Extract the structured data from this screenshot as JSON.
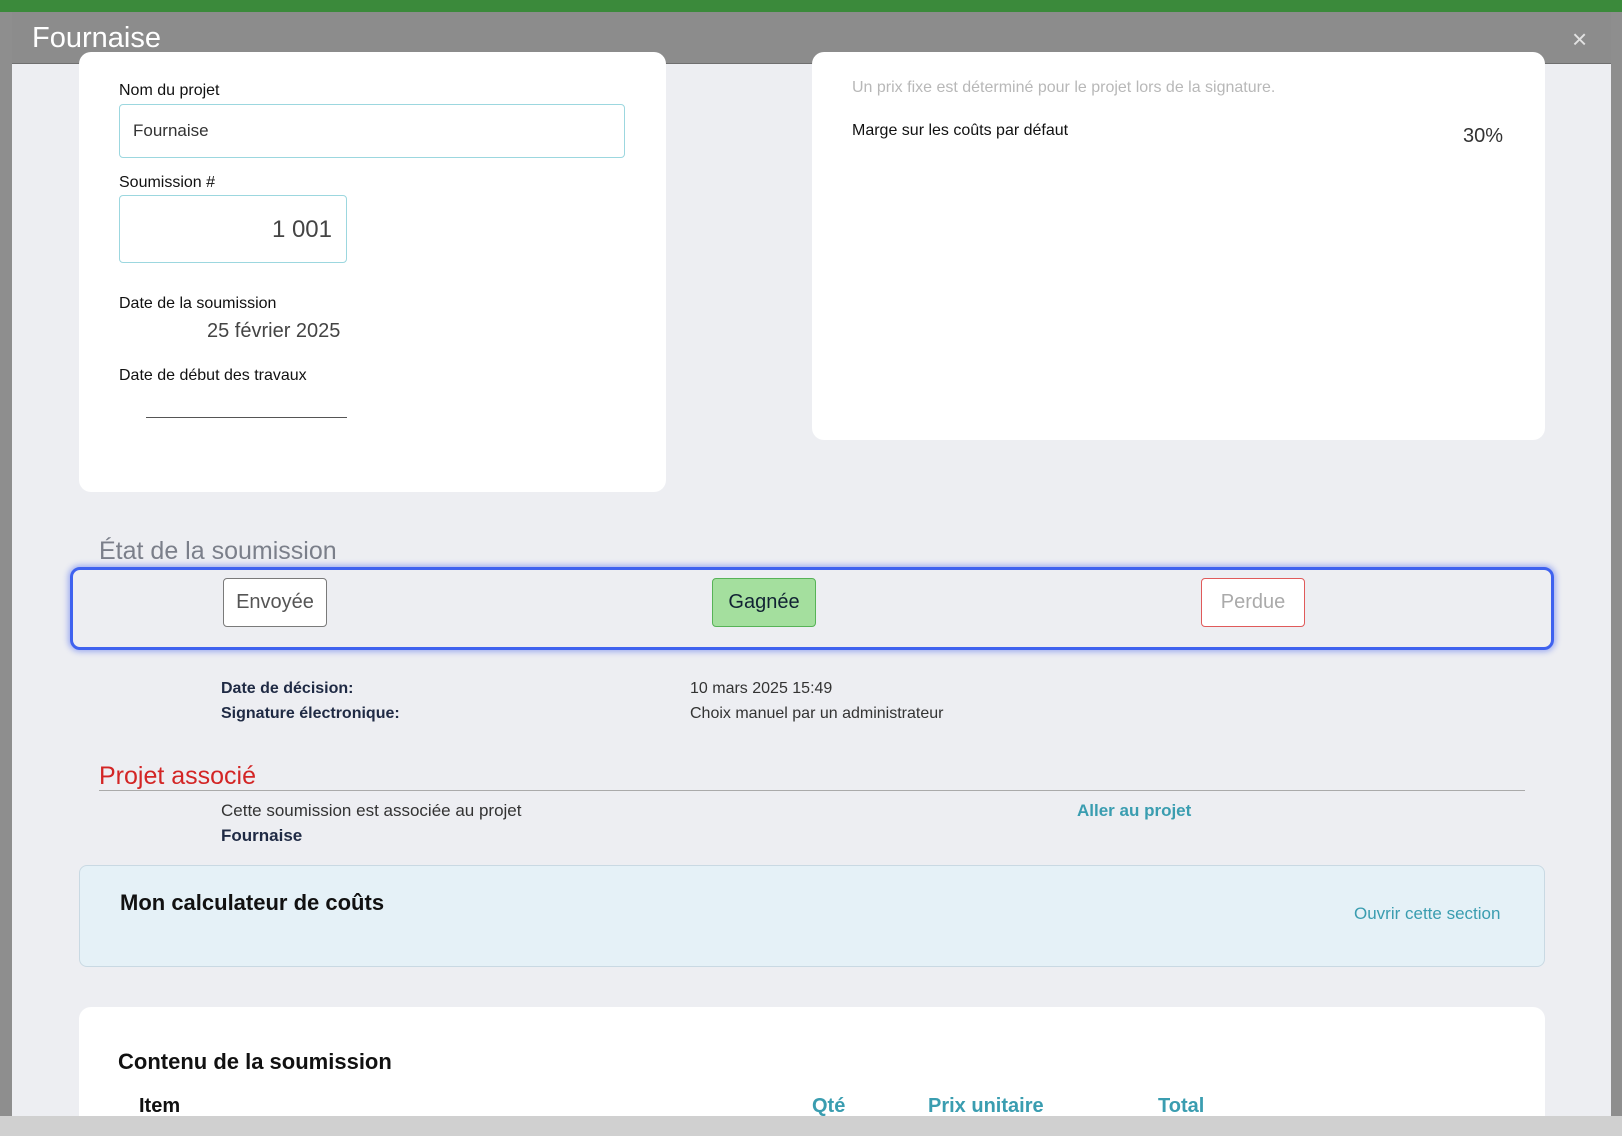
{
  "modal": {
    "title": "Fournaise",
    "close_label": "×"
  },
  "project_card": {
    "project_name_label": "Nom du projet",
    "project_name_value": "Fournaise",
    "quote_number_label": "Soumission #",
    "quote_number_value": "1 001",
    "quote_date_label": "Date de la soumission",
    "quote_date_value": "25 février 2025",
    "start_date_label": "Date de début des travaux",
    "start_date_value": ""
  },
  "pricing_card": {
    "fixed_price_note": "Un prix fixe est déterminé pour le projet lors de la signature.",
    "default_margin_label": "Marge sur les coûts par défaut",
    "default_margin_value": "30%"
  },
  "status_section": {
    "title": "État de la soumission",
    "buttons": {
      "sent": "Envoyée",
      "won": "Gagnée",
      "lost": "Perdue"
    },
    "selected": "won",
    "decision_date_label": "Date de décision:",
    "decision_date_value": "10 mars 2025 15:49",
    "esignature_label": "Signature électronique:",
    "esignature_value": "Choix manuel par un administrateur"
  },
  "associated_project": {
    "title": "Projet associé",
    "description": "Cette soumission est associée au projet",
    "project_name": "Fournaise",
    "go_link": "Aller au projet"
  },
  "cost_calculator": {
    "title": "Mon calculateur de coûts",
    "open_link": "Ouvrir cette section"
  },
  "quote_content": {
    "title": "Contenu de la soumission",
    "columns": [
      "Item",
      "Qté",
      "Prix unitaire",
      "Total"
    ]
  },
  "colors": {
    "accent": "#3a9db0",
    "won_green": "#a4df9e",
    "lost_red": "#e05a5a",
    "focus_blue": "#3f62ef",
    "associated_red": "#d32525"
  }
}
